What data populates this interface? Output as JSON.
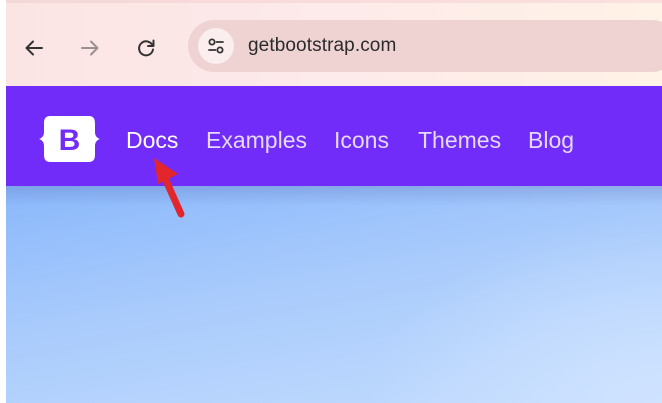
{
  "browser": {
    "url": "getbootstrap.com",
    "icons": {
      "back": "arrow-left-icon",
      "forward": "arrow-right-icon",
      "reload": "reload-icon",
      "site_info": "tune-icon"
    }
  },
  "navbar": {
    "brand_letter": "B",
    "links": [
      "Docs",
      "Examples",
      "Icons",
      "Themes",
      "Blog"
    ]
  },
  "colors": {
    "brand": "#712cf9",
    "annotation_arrow": "#e3262b"
  },
  "annotation": {
    "icon": "red-arrow-icon"
  }
}
